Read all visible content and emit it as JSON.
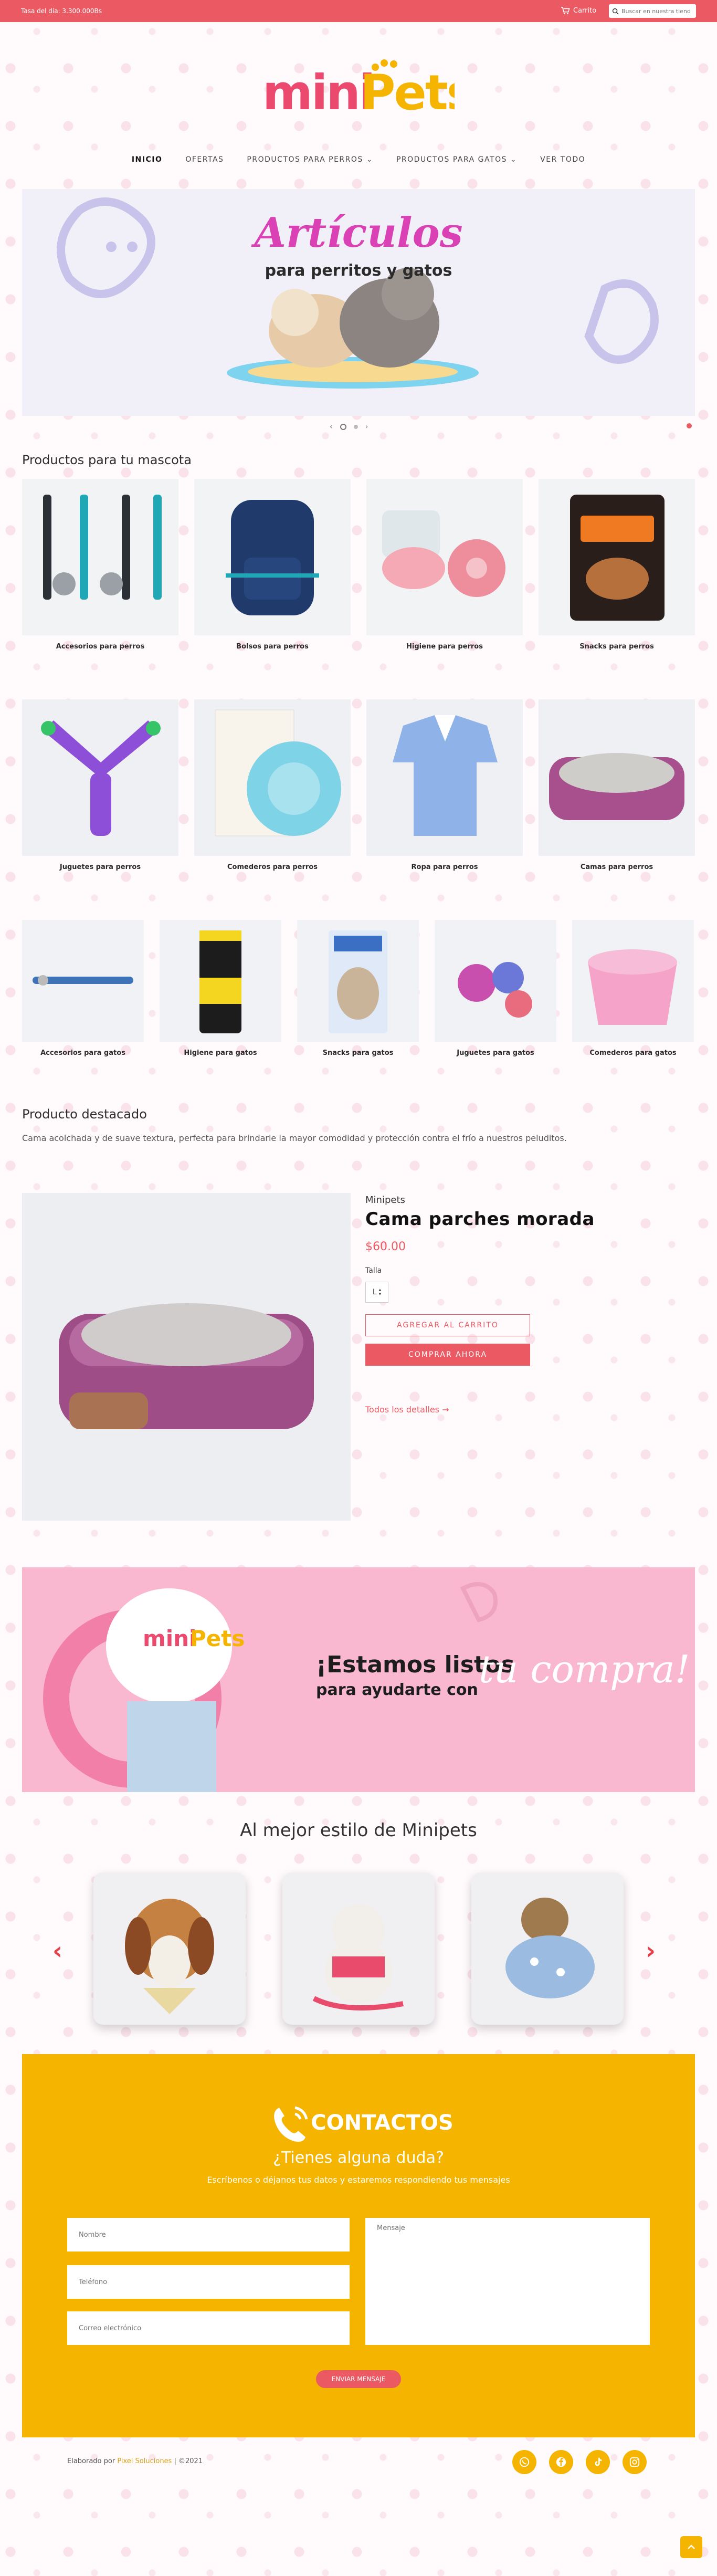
{
  "topbar": {
    "rate": "Tasa del día: 3.300.000Bs",
    "cart_label": "Carrito",
    "search_placeholder": "Buscar en nuestra tienda"
  },
  "logo": {
    "text": "miniPets"
  },
  "nav": [
    {
      "label": "Inicio",
      "active": true
    },
    {
      "label": "Ofertas"
    },
    {
      "label": "Productos para perros ⌄"
    },
    {
      "label": "Productos para gatos ⌄"
    },
    {
      "label": "Ver todo"
    }
  ],
  "hero": {
    "title": "Artículos",
    "subtitle": "para perritos y gatos"
  },
  "categories_title": "Productos para tu mascota",
  "dog_categories": [
    "Accesorios para perros",
    "Bolsos para perros",
    "Higiene para perros",
    "Snacks para perros",
    "Juguetes para perros",
    "Comederos para perros",
    "Ropa para perros",
    "Camas para perros"
  ],
  "cat_categories": [
    "Accesorios para gatos",
    "Higiene para gatos",
    "Snacks para gatos",
    "Juguetes para gatos",
    "Comederos para gatos"
  ],
  "featured": {
    "section_title": "Producto destacado",
    "description": "Cama acolchada y de suave textura, perfecta para brindarle la mayor comodidad y protección contra el frío a nuestros peluditos.",
    "brand": "Minipets",
    "title": "Cama parches morada",
    "price": "$60.00",
    "size_label": "Talla",
    "size_value": "L",
    "add_to_cart": "AGREGAR AL CARRITO",
    "buy_now": "COMPRAR AHORA",
    "details_link": "Todos los detalles →"
  },
  "promo": {
    "line1": "¡Estamos listos",
    "line2": "para ayudarte con",
    "accent": "tu compra!"
  },
  "best_style": {
    "title": "Al mejor estilo de Minipets"
  },
  "contact": {
    "title": "CONTACTOS",
    "question": "¿Tienes alguna duda?",
    "text": "Escríbenos o déjanos tus datos y estaremos respondiendo tus mensajes",
    "name_placeholder": "Nombre",
    "phone_placeholder": "Teléfono",
    "email_placeholder": "Correo electrónico",
    "message_placeholder": "Mensaje",
    "send": "ENVIAR MENSAJE"
  },
  "footer": {
    "prefix": "Elaborado por",
    "company": "Pixel Soluciones",
    "suffix": "| ©2021"
  },
  "social_icons": [
    "whatsapp-icon",
    "facebook-icon",
    "tiktok-icon",
    "instagram-icon"
  ],
  "colors": {
    "brand_red": "#eb5a63",
    "brand_yellow": "#f5b400",
    "brand_pink": "#d941b4"
  }
}
